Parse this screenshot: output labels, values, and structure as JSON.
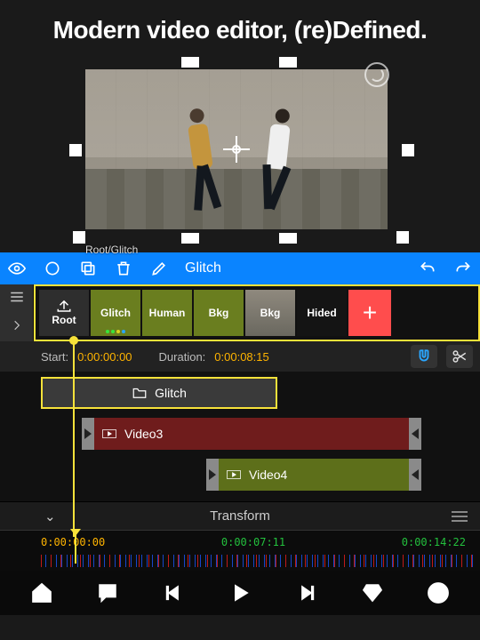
{
  "headline": "Modern video editor, (re)Defined.",
  "breadcrumb": "Root/Glitch",
  "toolbar": {
    "title": "Glitch"
  },
  "shelf": {
    "root_label": "Root",
    "items": [
      {
        "label": "Glitch",
        "kind": "green",
        "dots": [
          "#37e63b",
          "#37e63b",
          "#d7d21e",
          "#2aa6ff"
        ]
      },
      {
        "label": "Human",
        "kind": "green"
      },
      {
        "label": "Bkg",
        "kind": "green"
      },
      {
        "label": "Bkg",
        "kind": "img"
      },
      {
        "label": "Hided",
        "kind": "dark"
      }
    ]
  },
  "timing": {
    "start_label": "Start:",
    "start_value": "0:00:00:00",
    "duration_label": "Duration:",
    "duration_value": "0:00:08:15"
  },
  "tracks": {
    "glitch_label": "Glitch",
    "video3_label": "Video3",
    "video4_label": "Video4"
  },
  "transform_label": "Transform",
  "ruler": {
    "t0": "0:00:00:00",
    "t1": "0:00:07:11",
    "t2": "0:00:14:22"
  }
}
